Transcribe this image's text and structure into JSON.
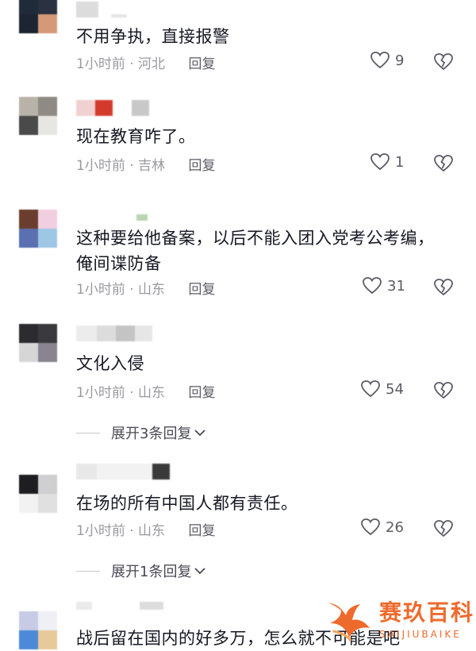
{
  "comments": [
    {
      "text": "不用争执，直接报警",
      "time": "1小时前",
      "location": "河北",
      "reply_label": "回复",
      "likes": "9",
      "avatar_colors": [
        "#1f2a3a",
        "#2a3140",
        "#1d2433",
        "#d49a78"
      ],
      "name_colors": [
        "#dcdcdc",
        "#ffffff",
        "#e4e4e4"
      ]
    },
    {
      "text": "现在教育咋了。",
      "time": "1小时前",
      "location": "吉林",
      "reply_label": "回复",
      "likes": "1",
      "avatar_colors": [
        "#b8b2a9",
        "#8f8a84",
        "#4a4a4a",
        "#e8e6e3"
      ],
      "name_colors": [
        "#f0d0d0",
        "#d43a2c",
        "#c8c8c8"
      ]
    },
    {
      "text": "这种要给他备案，以后不能入团入党考公考编，俺间谍防备",
      "time": "1小时前",
      "location": "山东",
      "reply_label": "回复",
      "likes": "31",
      "avatar_colors": [
        "#6a3d2e",
        "#f2cfe0",
        "#5a70b0",
        "#9ec7e6"
      ],
      "name_colors": [
        "#b9d4b0",
        "#ffffff"
      ]
    },
    {
      "text": "文化入侵",
      "time": "1小时前",
      "location": "山东",
      "reply_label": "回复",
      "likes": "54",
      "avatar_colors": [
        "#2c2c30",
        "#3a3a3e",
        "#d6d6d6",
        "#8a8490"
      ],
      "name_colors": [
        "#ececec",
        "#dcdcdc",
        "#c4c4c4",
        "#e6e6e6"
      ],
      "expand_label": "展开3条回复"
    },
    {
      "text": "在场的所有中国人都有责任。",
      "time": "1小时前",
      "location": "山东",
      "reply_label": "回复",
      "likes": "26",
      "avatar_colors": [
        "#1e1e22",
        "#cfcfd2",
        "#f2f2f2",
        "#e0e0e0"
      ],
      "name_colors": [
        "#e8e8e8",
        "#f2f2f2",
        "#3a3a3a"
      ],
      "expand_label": "展开1条回复"
    },
    {
      "text": "战后留在国内的好多万，怎么就不可能是吧",
      "time": "",
      "location": "",
      "reply_label": "",
      "likes": "",
      "avatar_colors": [
        "#c7cbe6",
        "#eef0f6",
        "#4a8ad8",
        "#e8c99a"
      ],
      "name_colors": [
        "#eaeaea",
        "#dcdcdc"
      ]
    }
  ],
  "meta_separator": " · ",
  "watermark": {
    "cn": "赛玖百科",
    "en": "SAIJIUBAIKE",
    "color": "#ee6a2c"
  },
  "icons": {
    "like": "heart-outline-icon",
    "dislike": "broken-heart-icon",
    "expand": "chevron-down-icon"
  }
}
